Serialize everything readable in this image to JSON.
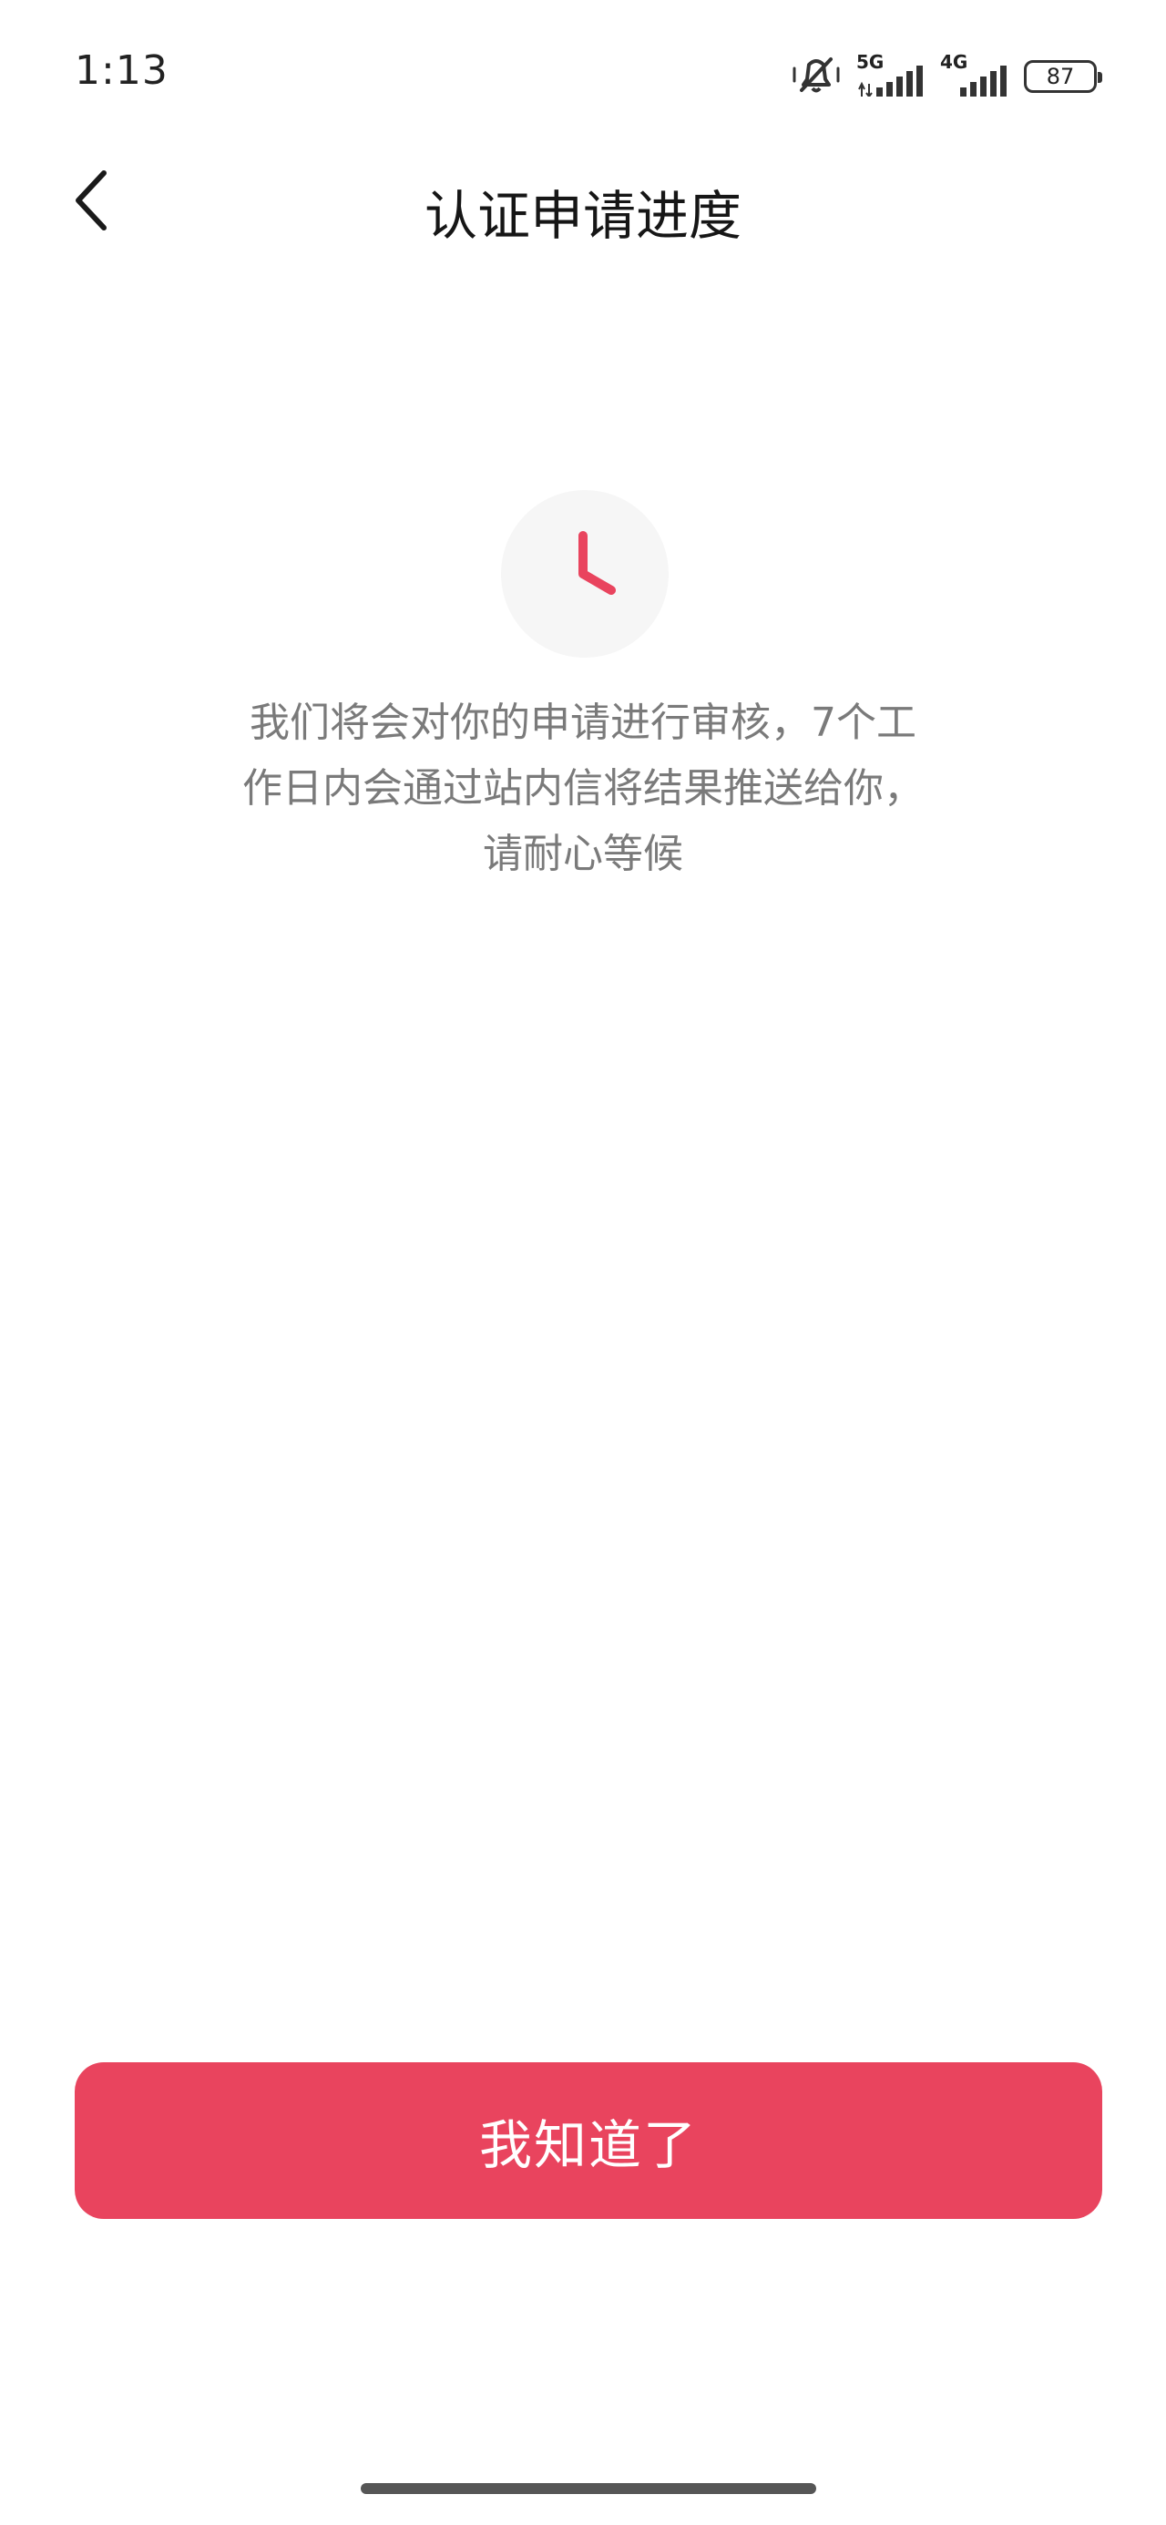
{
  "status_bar": {
    "time": "1:13",
    "network_1": "5G",
    "network_2": "4G",
    "battery": "87",
    "icons": [
      "mute-vibrate-icon",
      "signal-5g-icon",
      "signal-4g-icon",
      "battery-icon"
    ]
  },
  "header": {
    "title": "认证申请进度",
    "back_icon": "chevron-left-icon"
  },
  "status": {
    "icon": "clock-icon",
    "accent_color": "#e9445e",
    "line_1": "我们将会对你的申请进行审核，7个工",
    "line_2": "作日内会通过站内信将结果推送给你，",
    "line_3": "请耐心等候"
  },
  "actions": {
    "confirm_label": "我知道了",
    "confirm_color": "#e9445e"
  }
}
